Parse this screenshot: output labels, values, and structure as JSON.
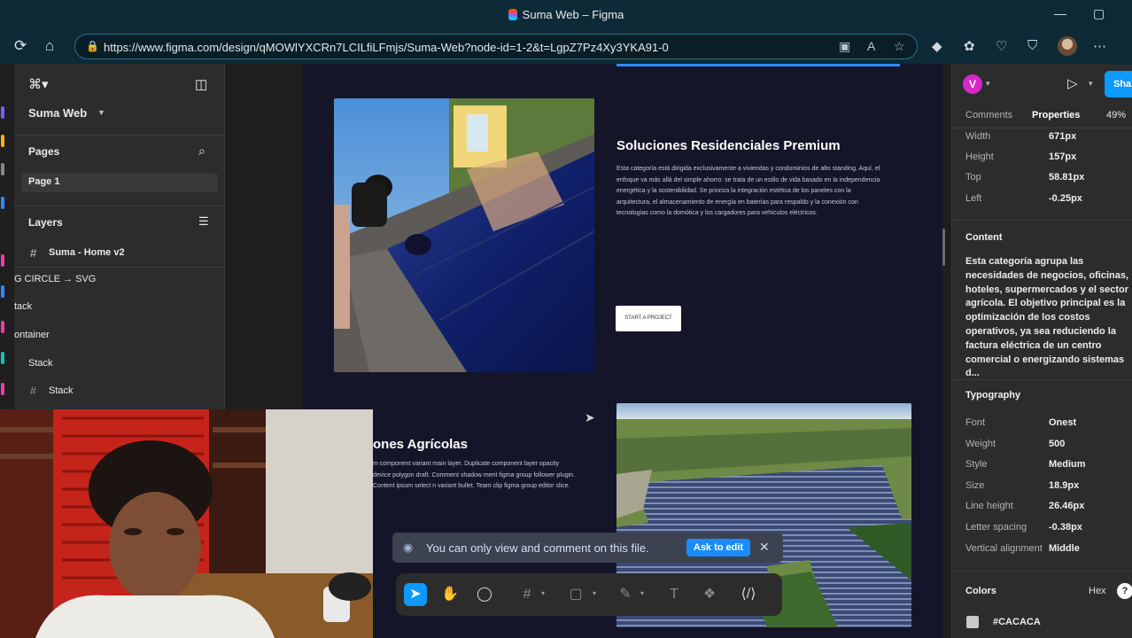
{
  "browser": {
    "window_title": "Suma Web – Figma",
    "url": "https://www.figma.com/design/qMOWlYXCRn7LCILfiLFmjs/Suma-Web?node-id=1-2&t=LgpZ7Pz4Xy3YKA91-0",
    "window_controls": [
      "—",
      "▢"
    ]
  },
  "left_panel": {
    "file_name": "Suma Web",
    "pages_header": "Pages",
    "current_page": "Page 1",
    "layers_header": "Layers",
    "layers": [
      {
        "label": "Suma - Home v2",
        "icon": "frame-icon"
      },
      {
        "label": "G CIRCLE → SVG",
        "icon": ""
      },
      {
        "label": "tack",
        "icon": ""
      },
      {
        "label": "ontainer",
        "icon": ""
      },
      {
        "label": "Stack",
        "icon": "chevron-right-icon"
      },
      {
        "label": "Stack",
        "icon": "frame-icon"
      }
    ]
  },
  "canvas": {
    "section1": {
      "title": "Soluciones Residenciales Premium",
      "body": "Esta categoría está dirigida exclusivamente a viviendas y condominios de alto standing. Aquí, el enfoque va más allá del simple ahorro: se trata de un estilo de vida basado en la independencia energética y la sostenibilidad. Se prioriza la integración estética de los paneles con la arquitectura, el almacenamiento de energía en baterías para respaldo y la conexión con tecnologías como la domótica y los cargadores para vehículos eléctricos.",
      "button": "START A PROJECT"
    },
    "section2": {
      "title": "ones Agrícolas",
      "body": "m component variant main layer. Duplicate component layer opacity device polygon draft. Comment shadow ment figma group follower plugin. Content ipsum select n variant bullet. Team clip figma group editor slice."
    }
  },
  "toast": {
    "message": "You can only view and comment on this file.",
    "action": "Ask to edit"
  },
  "right_panel": {
    "avatar_letter": "V",
    "share_label": "Sha",
    "tabs": [
      "Comments",
      "Properties"
    ],
    "zoom": "49%",
    "layout_props": [
      {
        "label": "Width",
        "value": "671px"
      },
      {
        "label": "Height",
        "value": "157px"
      },
      {
        "label": "Top",
        "value": "58.81px"
      },
      {
        "label": "Left",
        "value": "-0.25px"
      }
    ],
    "content_header": "Content",
    "content_text": "Esta categoría agrupa las necesidades de negocios, oficinas, hoteles, supermercados y el sector agrícola. El objetivo principal es la optimización de los costos operativos, ya sea reduciendo la factura eléctrica de un centro comercial o energizando sistemas d...",
    "typography_header": "Typography",
    "typography": [
      {
        "label": "Font",
        "value": "Onest"
      },
      {
        "label": "Weight",
        "value": "500"
      },
      {
        "label": "Style",
        "value": "Medium"
      },
      {
        "label": "Size",
        "value": "18.9px"
      },
      {
        "label": "Line height",
        "value": "26.46px"
      },
      {
        "label": "Letter spacing",
        "value": "-0.38px"
      },
      {
        "label": "Vertical alignment",
        "value": "Middle"
      }
    ],
    "colors_header": "Colors",
    "color_format": "Hex",
    "color_value": "#CACACA",
    "help": "?"
  },
  "colors": {
    "accent": "#0d99ff",
    "canvas_frame": "#15152a",
    "browser_chrome": "#0d2a36"
  }
}
